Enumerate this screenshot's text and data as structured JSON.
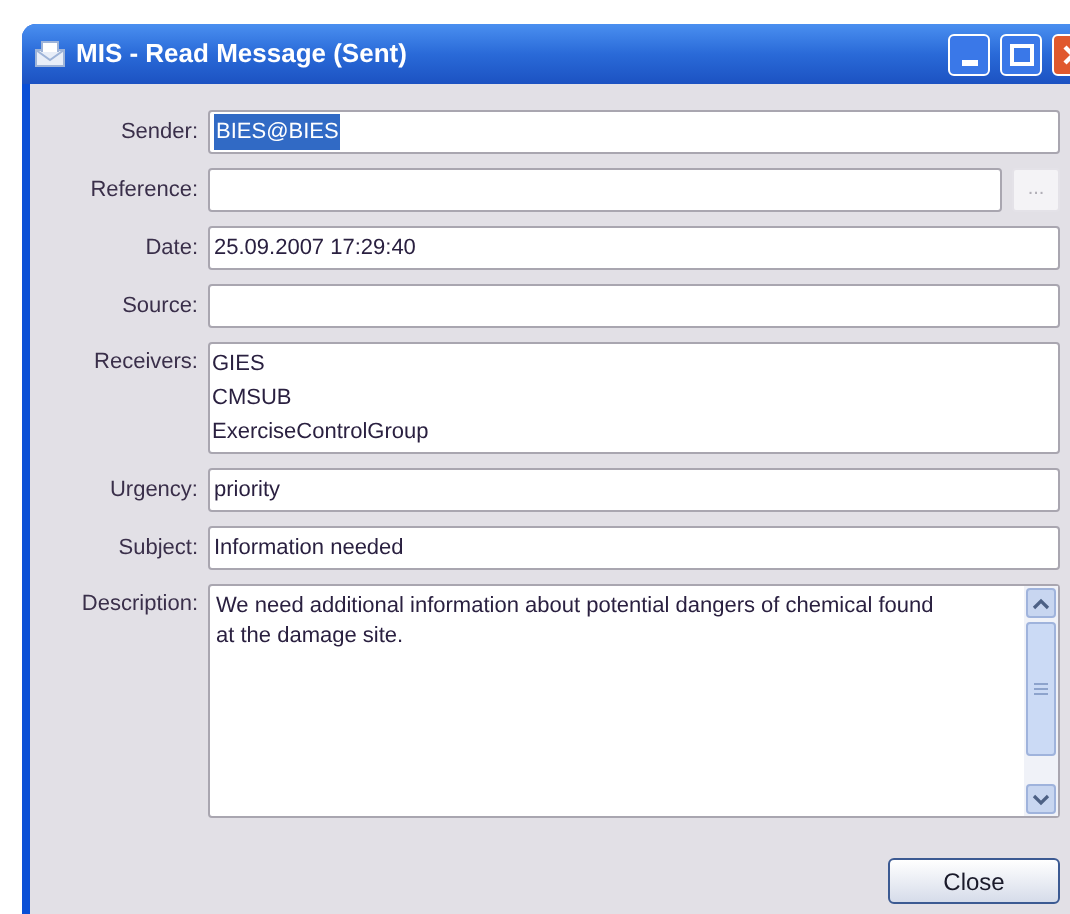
{
  "window": {
    "title": "MIS - Read Message (Sent)"
  },
  "fields": [
    {
      "kind": "text",
      "label": "Sender:",
      "value": "BIES@BIES",
      "highlighted": true
    },
    {
      "kind": "browse",
      "label": "Reference:",
      "button": "..."
    },
    {
      "kind": "text",
      "label": "Date:",
      "value": "25.09.2007 17:29:40"
    },
    {
      "kind": "text",
      "label": "Source:"
    },
    {
      "kind": "list",
      "label": "Receivers:",
      "items": [
        "GIES",
        "CMSUB",
        "ExerciseControlGroup"
      ]
    },
    {
      "kind": "text",
      "label": "Urgency:",
      "value": "priority"
    },
    {
      "kind": "text",
      "label": "Subject:",
      "value": "Information needed"
    },
    {
      "kind": "textarea",
      "label": "Description:",
      "value": "We need additional information about potential dangers of chemical found at the damage site."
    }
  ],
  "buttons": [
    "Close"
  ]
}
